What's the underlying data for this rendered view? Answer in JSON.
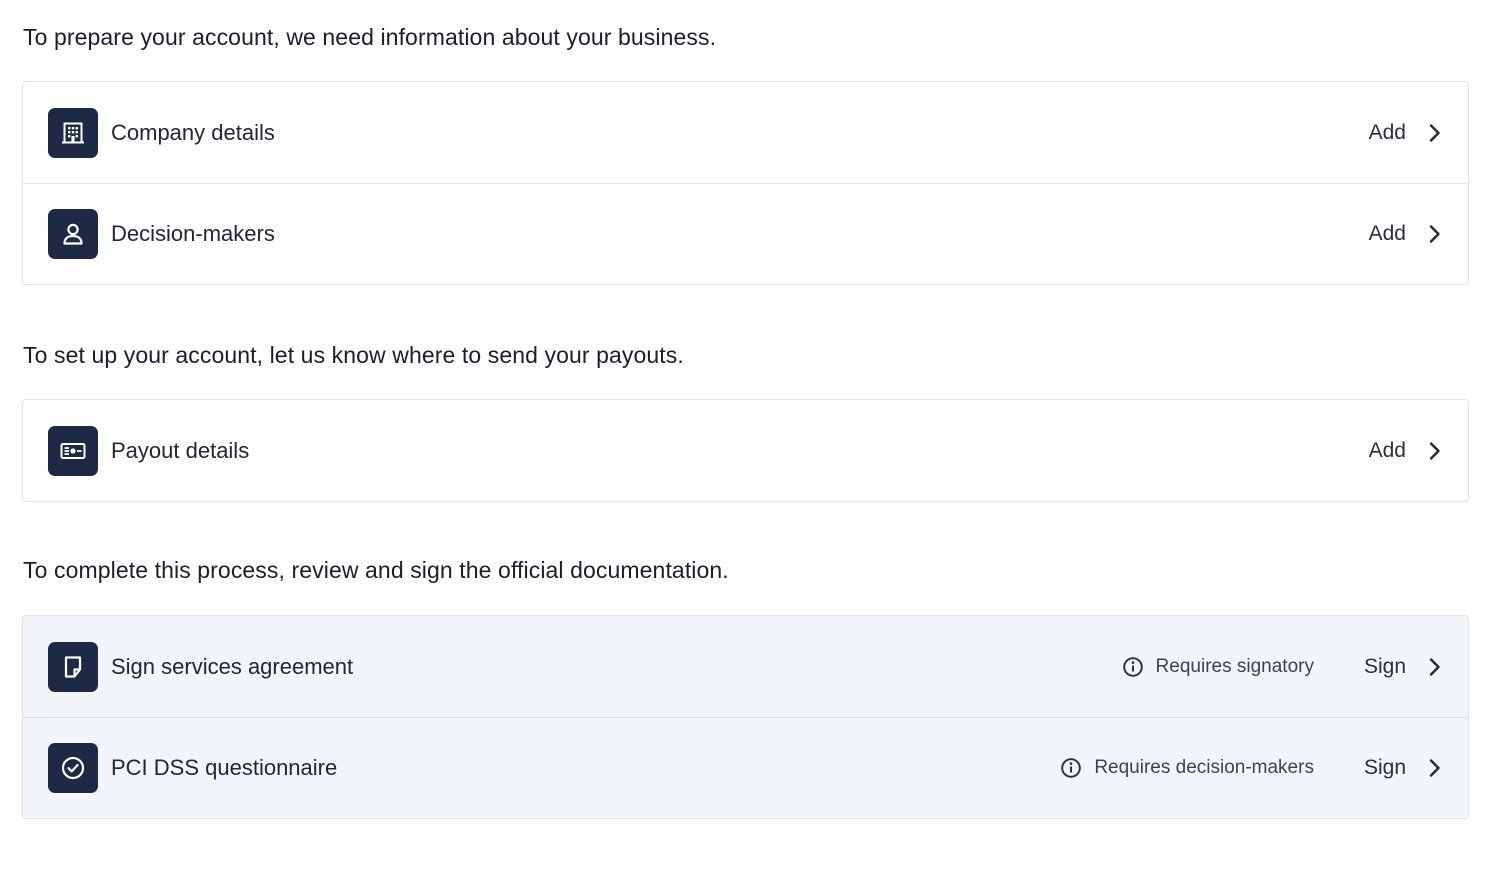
{
  "sections": [
    {
      "heading": "To prepare your account, we need information about your business.",
      "items": [
        {
          "icon": "building-icon",
          "label": "Company details",
          "action": "Add"
        },
        {
          "icon": "person-icon",
          "label": "Decision-makers",
          "action": "Add"
        }
      ]
    },
    {
      "heading": "To set up your account, let us know where to send your payouts.",
      "items": [
        {
          "icon": "bank-card-icon",
          "label": "Payout details",
          "action": "Add"
        }
      ]
    },
    {
      "heading": "To complete this process, review and sign the official documentation.",
      "items": [
        {
          "icon": "document-icon",
          "label": "Sign services agreement",
          "status": "Requires signatory",
          "status_icon": "info-icon",
          "action": "Sign"
        },
        {
          "icon": "check-circle-icon",
          "label": "PCI DSS questionnaire",
          "status": "Requires decision-makers",
          "status_icon": "info-icon",
          "action": "Sign"
        }
      ]
    }
  ],
  "colors": {
    "icon_tile": "#1e2a45",
    "card_border": "#dfe2e6",
    "disabled_card_bg": "#f2f5f9",
    "text": "#1a1d2e"
  }
}
